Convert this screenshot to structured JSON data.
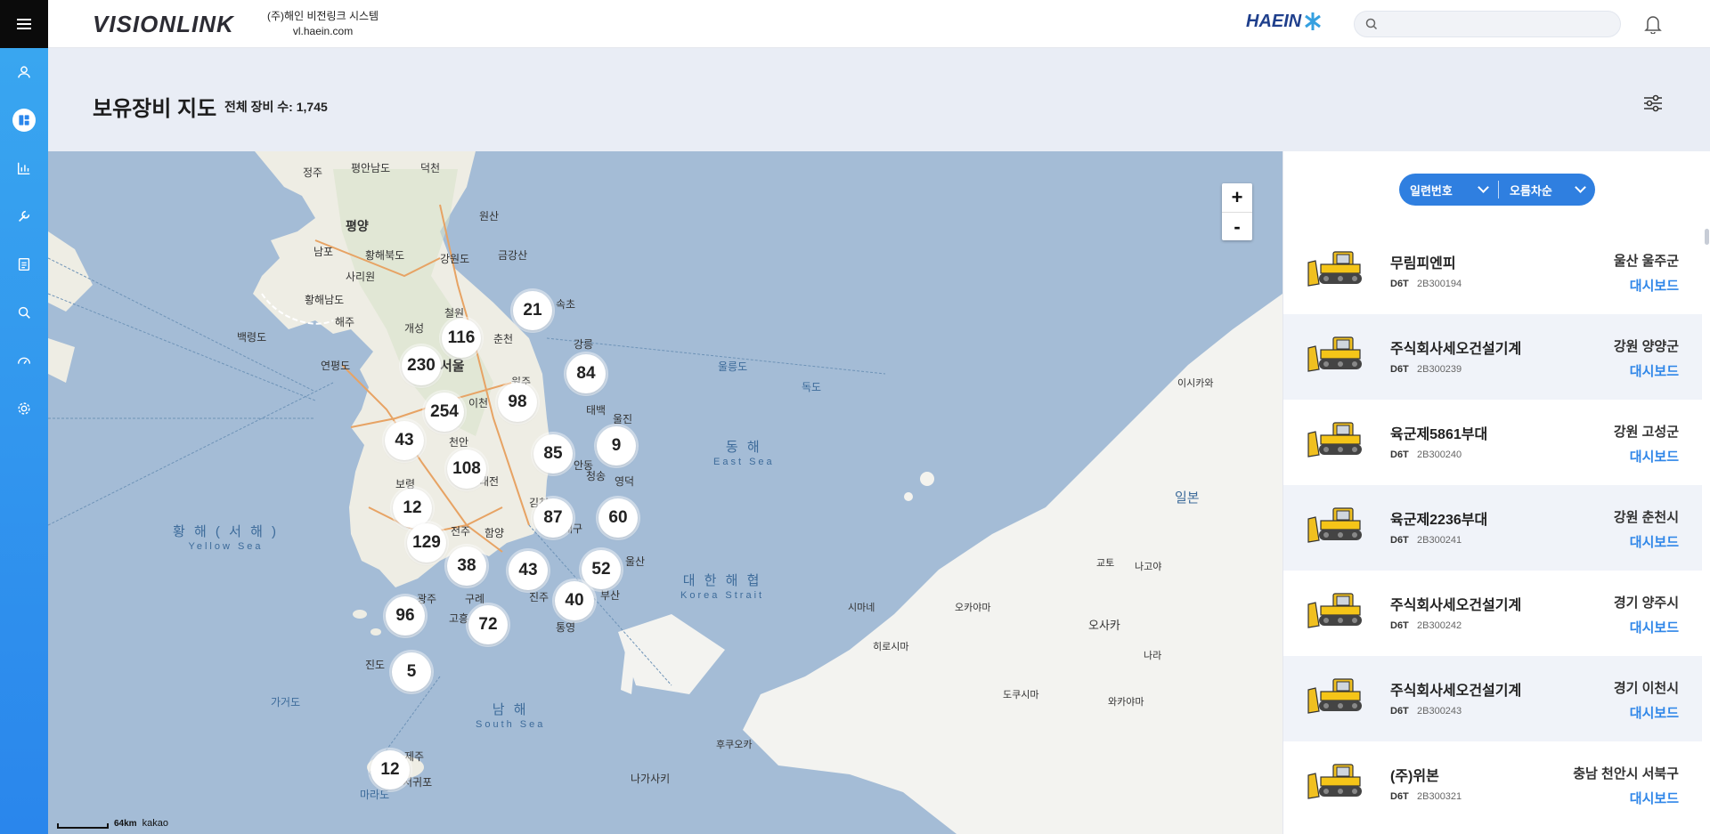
{
  "header": {
    "logo": "VISIONLINK",
    "company_name": "(주)해인 비전링크 시스템",
    "company_url": "vl.haein.com",
    "partner_logo": "HAEIN",
    "search_placeholder": ""
  },
  "page": {
    "title": "보유장비 지도",
    "total_label": "전체 장비 수: 1,745"
  },
  "sidebar": {
    "items": [
      {
        "icon": "user-icon"
      },
      {
        "icon": "dashboard-icon",
        "active": true
      },
      {
        "icon": "chart-icon"
      },
      {
        "icon": "wrench-icon"
      },
      {
        "icon": "report-icon"
      },
      {
        "icon": "search-doc-icon"
      },
      {
        "icon": "gauge-icon"
      },
      {
        "icon": "gear-icon"
      }
    ]
  },
  "map": {
    "zoom_in": "+",
    "zoom_out": "-",
    "scale_text": "64km",
    "provider": "kakao",
    "clusters": [
      {
        "count": "21"
      },
      {
        "count": "116"
      },
      {
        "count": "230"
      },
      {
        "count": "84"
      },
      {
        "count": "254"
      },
      {
        "count": "98"
      },
      {
        "count": "43"
      },
      {
        "count": "85"
      },
      {
        "count": "9"
      },
      {
        "count": "108"
      },
      {
        "count": "12"
      },
      {
        "count": "87"
      },
      {
        "count": "60"
      },
      {
        "count": "129"
      },
      {
        "count": "38"
      },
      {
        "count": "43"
      },
      {
        "count": "52"
      },
      {
        "count": "40"
      },
      {
        "count": "96"
      },
      {
        "count": "72"
      },
      {
        "count": "5"
      },
      {
        "count": "12"
      }
    ],
    "places": [
      "정주",
      "평안남도",
      "덕천",
      "평양",
      "원산",
      "남포",
      "사리원",
      "강원도",
      "금강산",
      "황해북도",
      "황해남도",
      "해주",
      "철원",
      "속초",
      "개성",
      "백령도",
      "연평도",
      "춘천",
      "서울",
      "강릉",
      "원주",
      "울릉도",
      "독도",
      "이천",
      "태백",
      "울진",
      "천안",
      "영덕",
      "보령",
      "안동",
      "청송",
      "대전",
      "김천",
      "전주",
      "대구",
      "울산",
      "함양",
      "진주",
      "광주",
      "구례",
      "부산",
      "통영",
      "고흥",
      "진도",
      "가거도",
      "제주",
      "서귀포",
      "마라도",
      "이시카와",
      "일본",
      "교토",
      "나고야",
      "시마네",
      "오카야마",
      "오사카",
      "나라",
      "히로시마",
      "도쿠시마",
      "와카야마",
      "후쿠오카",
      "나가사키"
    ],
    "seas": {
      "east": {
        "ko": "동 해",
        "en": "East Sea"
      },
      "yellow": {
        "ko": "황 해 ( 서 해 )",
        "en": "Yellow Sea"
      },
      "south": {
        "ko": "남 해",
        "en": "South Sea"
      },
      "strait": {
        "ko": "대 한 해 협",
        "en": "Korea Strait"
      }
    }
  },
  "panel": {
    "sort_field": "일련번호",
    "sort_order": "오름차순",
    "items": [
      {
        "name": "무림피엔피",
        "model": "D6T",
        "serial": "2B300194",
        "region": "울산 울주군",
        "link": "대시보드"
      },
      {
        "name": "주식회사세오건설기계",
        "model": "D6T",
        "serial": "2B300239",
        "region": "강원 양양군",
        "link": "대시보드"
      },
      {
        "name": "육군제5861부대",
        "model": "D6T",
        "serial": "2B300240",
        "region": "강원 고성군",
        "link": "대시보드"
      },
      {
        "name": "육군제2236부대",
        "model": "D6T",
        "serial": "2B300241",
        "region": "강원 춘천시",
        "link": "대시보드"
      },
      {
        "name": "주식회사세오건설기계",
        "model": "D6T",
        "serial": "2B300242",
        "region": "경기 양주시",
        "link": "대시보드"
      },
      {
        "name": "주식회사세오건설기계",
        "model": "D6T",
        "serial": "2B300243",
        "region": "경기 이천시",
        "link": "대시보드"
      },
      {
        "name": "(주)위본",
        "model": "D6T",
        "serial": "2B300321",
        "region": "충남 천안시 서북구",
        "link": "대시보드"
      }
    ]
  },
  "colors": {
    "accent": "#2f7fe0",
    "rail": "#2a86ec",
    "sea": "#a4bcd6",
    "land": "#f2f1ec"
  }
}
